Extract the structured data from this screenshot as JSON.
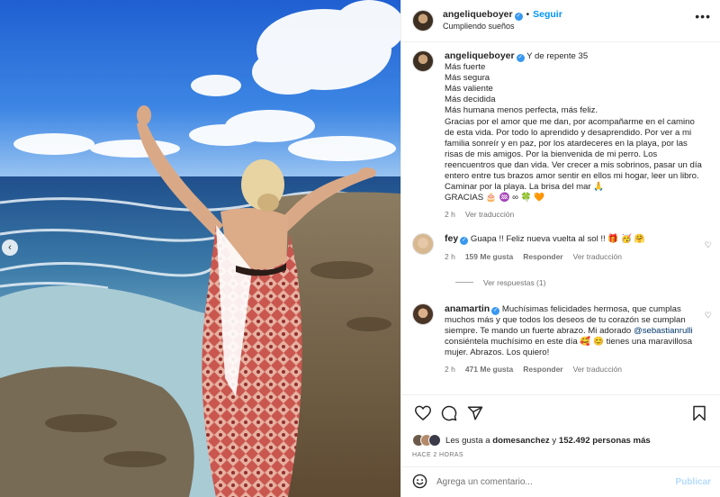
{
  "colors": {
    "accent": "#0095f6",
    "verified": "#3897f0",
    "muted": "#737373",
    "text": "#262626"
  },
  "photo": {
    "alt_icon": "chevron-left-icon"
  },
  "header": {
    "username": "angeliqueboyer",
    "separator": "•",
    "follow_label": "Seguir",
    "subtitle": "Cumpliendo sueños",
    "more_icon": "more-options-icon"
  },
  "caption": {
    "username": "angeliqueboyer",
    "lines": [
      "Y de repente 35",
      "Más fuerte",
      "Más segura",
      "Más valiente",
      "Más decidida",
      "Más humana menos perfecta, más feliz.",
      "Gracias por el amor que me dan, por acompañarme en el camino de esta vida. Por todo lo aprendido y desaprendido. Por ver a mi familia sonreír y en paz, por los atardeceres en la playa, por las risas de mis amigos. Por la bienvenida de mi perro. Los reencuentros que dan vida. Ver crecer a mis sobrinos, pasar un día entero entre tus brazos amor sentir en ellos mi hogar, leer un libro. Caminar por la playa. La brisa del mar 🙏",
      "GRACIAS 🎂 ♒ ∞ 🍀 🧡"
    ],
    "time": "2 h",
    "translate": "Ver traducción"
  },
  "comments": [
    {
      "username": "fey",
      "text": "Guapa !! Feliz nueva vuelta al sol !! 🎁 🥳 🤗",
      "time": "2 h",
      "likes": "159 Me gusta",
      "reply": "Responder",
      "translate": "Ver traducción"
    },
    {
      "username": "anamartin",
      "text_before": "Muchísimas felicidades hermosa, que cumplas muchos más y que todos los deseos de tu corazón se cumplan siempre. Te mando un fuerte abrazo. Mi adorado",
      "mention": "@sebastianrulli",
      "text_after": "consiéntela muchísimo en este día 🥰 😊 tienes una maravillosa mujer. Abrazos. Los quiero!",
      "time": "2 h",
      "likes": "471 Me gusta",
      "reply": "Responder",
      "translate": "Ver traducción"
    }
  ],
  "view_replies": "Ver respuestas (1)",
  "likes": {
    "prefix": "Les gusta a",
    "user": "domesanchez",
    "middle": "y",
    "count": "152.492 personas más"
  },
  "time_ago": "HACE 2 HORAS",
  "add_comment": {
    "placeholder": "Agrega un comentario...",
    "publish": "Publicar"
  }
}
